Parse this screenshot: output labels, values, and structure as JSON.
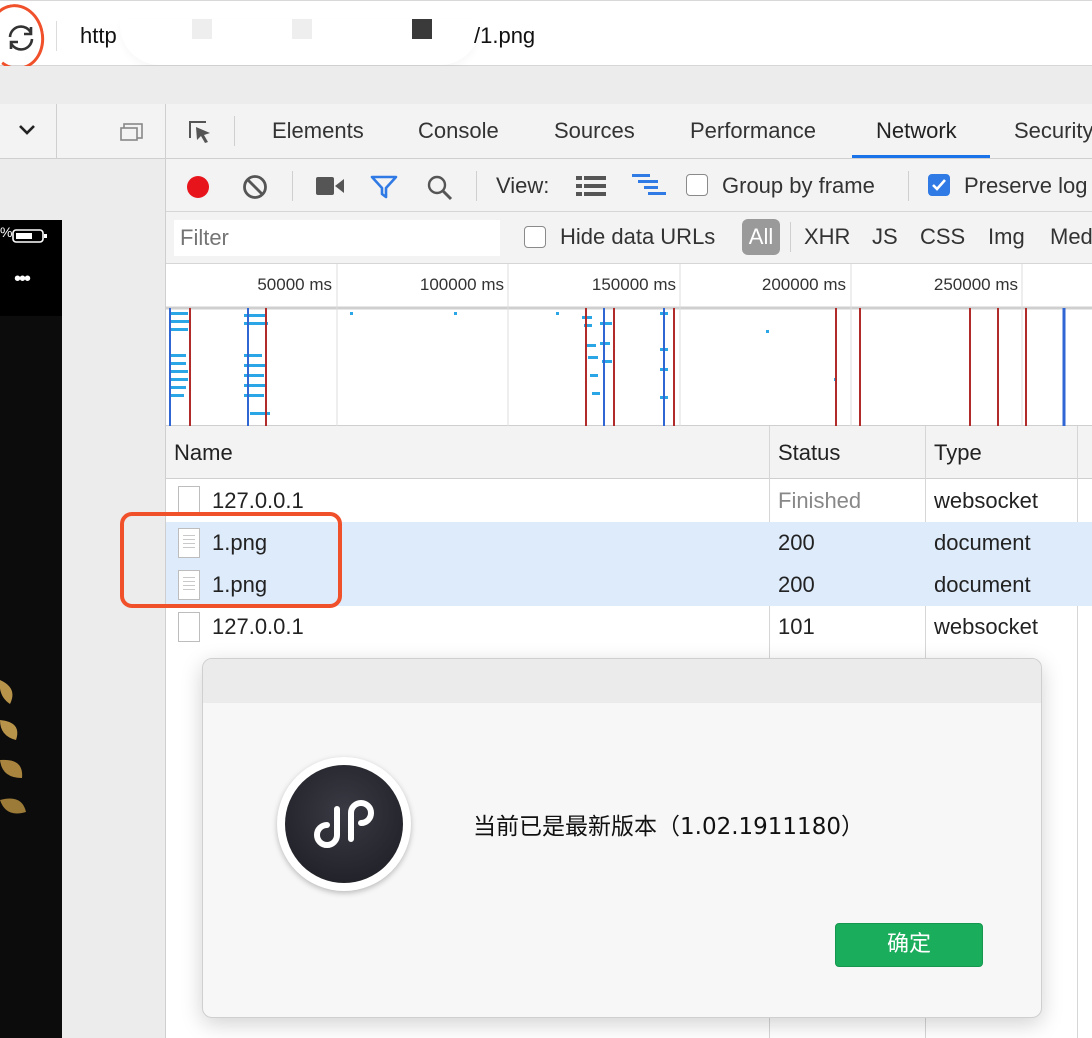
{
  "urlbar": {
    "url_prefix": "http",
    "url_suffix": "/1.png"
  },
  "simulator": {
    "dropdown_icon": "chevron-down-icon",
    "status_battery": "%",
    "menu_dots": "•••"
  },
  "devtools": {
    "tabs": [
      "Elements",
      "Console",
      "Sources",
      "Performance",
      "Network",
      "Security"
    ],
    "active_tab": "Network",
    "accent": "#1a73e8"
  },
  "network_toolbar": {
    "view_label": "View:",
    "group_by_frame": "Group by frame",
    "preserve_log": "Preserve log",
    "record_color": "#e8141b"
  },
  "filter": {
    "placeholder": "Filter",
    "hide_data_urls": "Hide data URLs",
    "types": [
      "All",
      "XHR",
      "JS",
      "CSS",
      "Img",
      "Media"
    ]
  },
  "overview": {
    "ticks": [
      "50000 ms",
      "100000 ms",
      "150000 ms",
      "200000 ms",
      "250000 ms"
    ]
  },
  "table": {
    "headers": [
      "Name",
      "Status",
      "Type"
    ],
    "rows": [
      {
        "name": "127.0.0.1",
        "status": "Finished",
        "type": "websocket",
        "icon": "plain"
      },
      {
        "name": "1.png",
        "status": "200",
        "type": "document",
        "icon": "doc"
      },
      {
        "name": "1.png",
        "status": "200",
        "type": "document",
        "icon": "doc"
      },
      {
        "name": "127.0.0.1",
        "status": "101",
        "type": "websocket",
        "icon": "plain"
      }
    ]
  },
  "dialog": {
    "message": "当前已是最新版本（1.02.1911180）",
    "ok_label": "确定",
    "ok_color": "#1aad5c"
  }
}
